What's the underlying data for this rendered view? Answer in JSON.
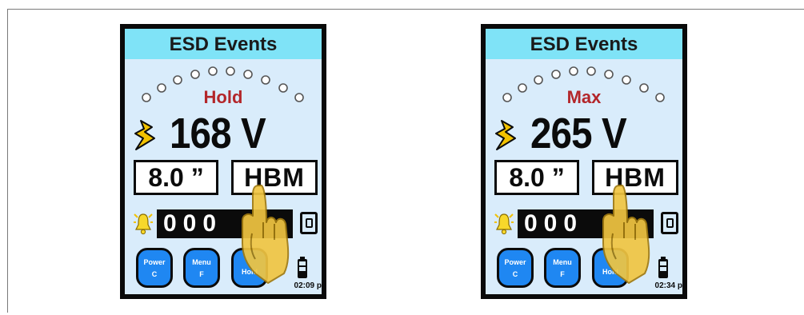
{
  "devices": [
    {
      "title": "ESD Events",
      "mode": "Hold",
      "voltage": "168 V",
      "distance": "8.0 ”",
      "model": "HBM",
      "counter": "000",
      "buttons": [
        {
          "label": "Power",
          "key": "C"
        },
        {
          "label": "Menu",
          "key": "F"
        },
        {
          "label": "Hold",
          "key": ""
        }
      ],
      "time": "02:09 p",
      "icons": [
        "lightning-bolt-icon",
        "bell-icon",
        "reset-icon",
        "battery-icon",
        "pointing-hand-icon"
      ]
    },
    {
      "title": "ESD Events",
      "mode": "Max",
      "voltage": "265 V",
      "distance": "8.0 ”",
      "model": "HBM",
      "counter": "000",
      "buttons": [
        {
          "label": "Power",
          "key": "C"
        },
        {
          "label": "Menu",
          "key": "F"
        },
        {
          "label": "Hold",
          "key": ""
        }
      ],
      "time": "02:34 p",
      "icons": [
        "lightning-bolt-icon",
        "bell-icon",
        "reset-icon",
        "battery-icon",
        "pointing-hand-icon"
      ]
    }
  ],
  "colors": {
    "title_bar": "#7fe3f7",
    "screen": "#d9ecfb",
    "mode_text": "#b3262a",
    "button": "#1f87f2",
    "bolt": "#f2c200",
    "hand": "#f0c542"
  }
}
